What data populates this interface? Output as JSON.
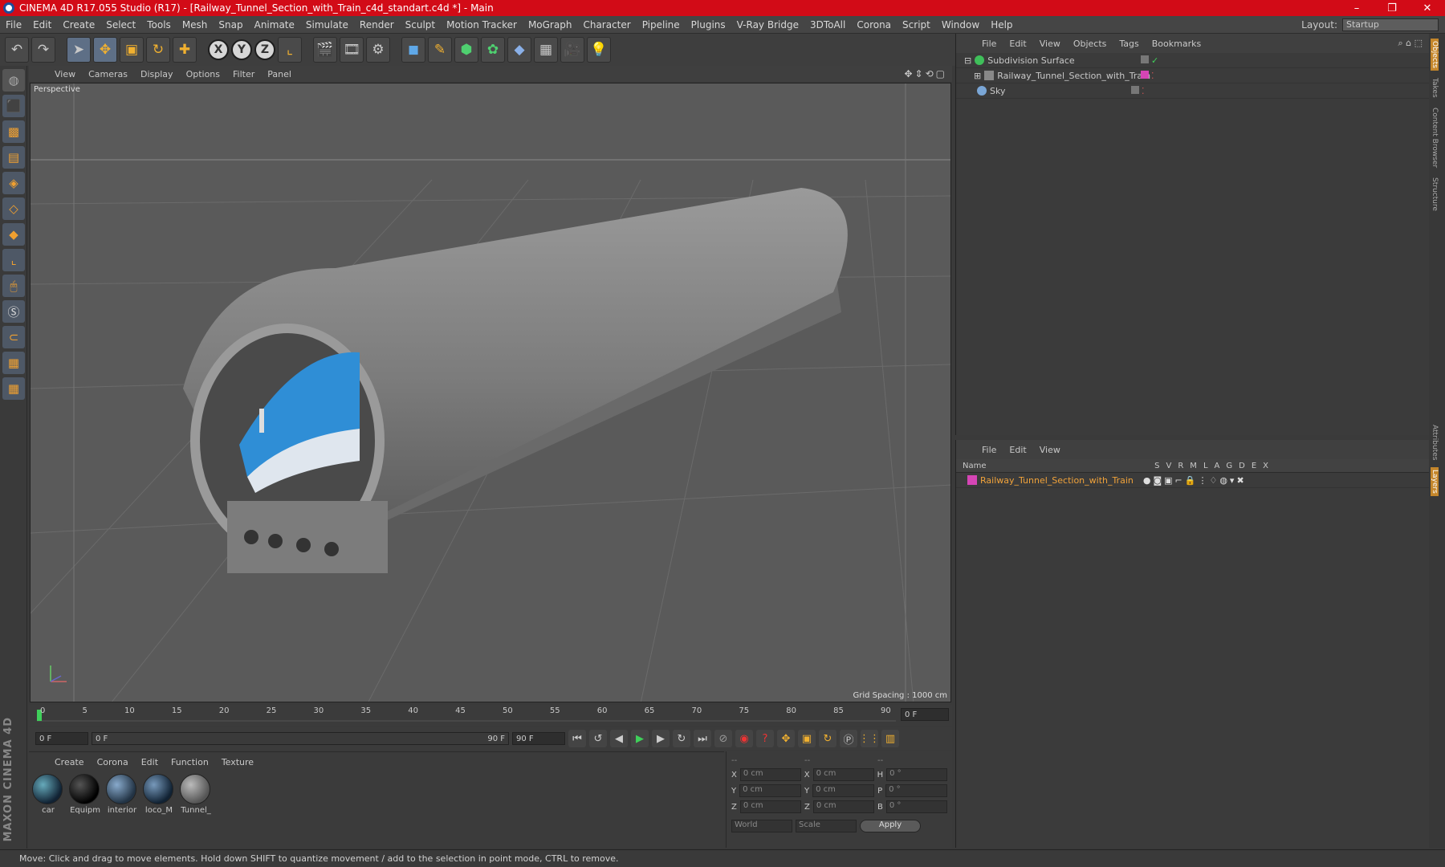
{
  "window": {
    "title": "CINEMA 4D R17.055 Studio (R17) - [Railway_Tunnel_Section_with_Train_c4d_standart.c4d *] - Main",
    "controls": [
      "–",
      "❐",
      "✕"
    ]
  },
  "menubar": {
    "items": [
      "File",
      "Edit",
      "Create",
      "Select",
      "Tools",
      "Mesh",
      "Snap",
      "Animate",
      "Simulate",
      "Render",
      "Sculpt",
      "Motion Tracker",
      "MoGraph",
      "Character",
      "Pipeline",
      "Plugins",
      "V-Ray Bridge",
      "3DToAll",
      "Corona",
      "Script",
      "Window",
      "Help"
    ],
    "layout_label": "Layout:",
    "layout_value": "Startup"
  },
  "toolbar": {
    "icons": [
      "undo-icon",
      "redo-icon",
      "select-icon",
      "move-icon",
      "scale-icon",
      "rotate-icon",
      "live-select-icon",
      "x-axis",
      "y-axis",
      "z-axis",
      "coordinate-system-icon",
      "render-view-icon",
      "render-picture-icon",
      "render-settings-icon",
      "cube-icon",
      "pen-icon",
      "subdivision-icon",
      "array-icon",
      "deformer-icon",
      "floor-icon",
      "camera-icon",
      "light-icon"
    ],
    "axis_x": "X",
    "axis_y": "Y",
    "axis_z": "Z"
  },
  "viewport": {
    "menu": [
      "View",
      "Cameras",
      "Display",
      "Options",
      "Filter",
      "Panel"
    ],
    "label": "Perspective",
    "grid_spacing": "Grid Spacing : 1000 cm"
  },
  "timeline": {
    "ticks": [
      "0",
      "5",
      "10",
      "15",
      "20",
      "25",
      "30",
      "35",
      "40",
      "45",
      "50",
      "55",
      "60",
      "65",
      "70",
      "75",
      "80",
      "85",
      "90"
    ],
    "current_frame": "0 F",
    "start_field": "0 F",
    "range_start": "0 F",
    "range_end": "90 F",
    "end_field": "90 F"
  },
  "materials": {
    "menu": [
      "Create",
      "Corona",
      "Edit",
      "Function",
      "Texture"
    ],
    "items": [
      "car",
      "Equipm",
      "interior",
      "loco_M",
      "Tunnel_"
    ]
  },
  "coords": {
    "head": [
      "--",
      "--",
      "--"
    ],
    "rows": [
      {
        "a": "X",
        "av": "0 cm",
        "b": "X",
        "bv": "0 cm",
        "c": "H",
        "cv": "0 °"
      },
      {
        "a": "Y",
        "av": "0 cm",
        "b": "Y",
        "bv": "0 cm",
        "c": "P",
        "cv": "0 °"
      },
      {
        "a": "Z",
        "av": "0 cm",
        "b": "Z",
        "bv": "0 cm",
        "c": "B",
        "cv": "0 °"
      }
    ],
    "mode1": "World",
    "mode2": "Scale",
    "apply": "Apply"
  },
  "objects": {
    "menu": [
      "File",
      "Edit",
      "View",
      "Objects",
      "Tags",
      "Bookmarks"
    ],
    "rows": [
      {
        "name": "Subdivision Surface",
        "color": "#3fbf5a"
      },
      {
        "name": "Railway_Tunnel_Section_with_Train",
        "color": "#c24bb0"
      },
      {
        "name": "Sky",
        "color": "#7aa6d6"
      }
    ]
  },
  "layers": {
    "menu": [
      "File",
      "Edit",
      "View"
    ],
    "header_name": "Name",
    "cols": [
      "S",
      "V",
      "R",
      "M",
      "L",
      "A",
      "G",
      "D",
      "E",
      "X"
    ],
    "row": "Railway_Tunnel_Section_with_Train"
  },
  "rightstrip": [
    "Objects",
    "Takes",
    "Content Browser",
    "Structure",
    "Attributes",
    "Layers"
  ],
  "status": "Move: Click and drag to move elements. Hold down SHIFT to quantize movement / add to the selection in point mode, CTRL to remove.",
  "brand": "MAXON CINEMA 4D"
}
